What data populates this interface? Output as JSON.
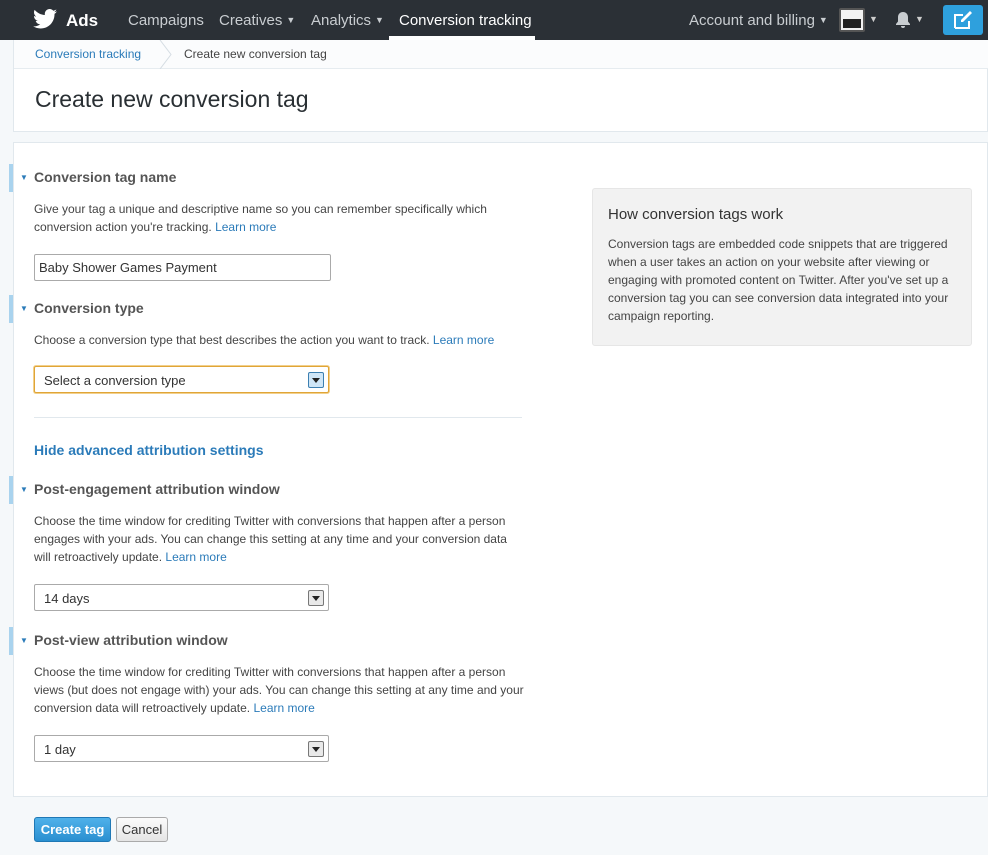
{
  "nav": {
    "brand": "Ads",
    "items": [
      {
        "label": "Campaigns"
      },
      {
        "label": "Creatives"
      },
      {
        "label": "Analytics"
      },
      {
        "label": "Conversion tracking"
      }
    ],
    "account": "Account and billing",
    "icons": {
      "logo": "twitter-bird-icon",
      "avatar": "avatar-icon",
      "bell": "bell-icon",
      "compose": "compose-icon"
    },
    "colors": {
      "bar": "#2b3036",
      "compose": "#2ea0dd"
    }
  },
  "breadcrumb": {
    "parent": "Conversion tracking",
    "current": "Create new conversion tag"
  },
  "page_title": "Create new conversion tag",
  "form": {
    "tag_name": {
      "title": "Conversion tag name",
      "desc": "Give your tag a unique and descriptive name so you can remember specifically which conversion action you're tracking.",
      "learn_more": "Learn more",
      "value": "Baby Shower Games Payment"
    },
    "conversion_type": {
      "title": "Conversion type",
      "desc": "Choose a conversion type that best describes the action you want to track.",
      "learn_more": "Learn more",
      "selected": "Select a conversion type"
    },
    "advanced_link": "Hide advanced attribution settings",
    "post_engagement": {
      "title": "Post-engagement attribution window",
      "desc": "Choose the time window for crediting Twitter with conversions that happen after a person engages with your ads. You can change this setting at any time and your conversion data will retroactively update.",
      "learn_more": "Learn more",
      "selected": "14 days"
    },
    "post_view": {
      "title": "Post-view attribution window",
      "desc": "Choose the time window for crediting Twitter with conversions that happen after a person views (but does not engage with) your ads. You can change this setting at any time and your conversion data will retroactively update.",
      "learn_more": "Learn more",
      "selected": "1 day"
    }
  },
  "info": {
    "title": "How conversion tags work",
    "body": "Conversion tags are embedded code snippets that are triggered when a user takes an action on your website after viewing or engaging with promoted content on Twitter. After you've set up a conversion tag you can see conversion data integrated into your campaign reporting."
  },
  "footer": {
    "create": "Create tag",
    "cancel": "Cancel"
  },
  "colors": {
    "accent": "#2b7bb9",
    "primary_button": "#2a8fd0"
  }
}
